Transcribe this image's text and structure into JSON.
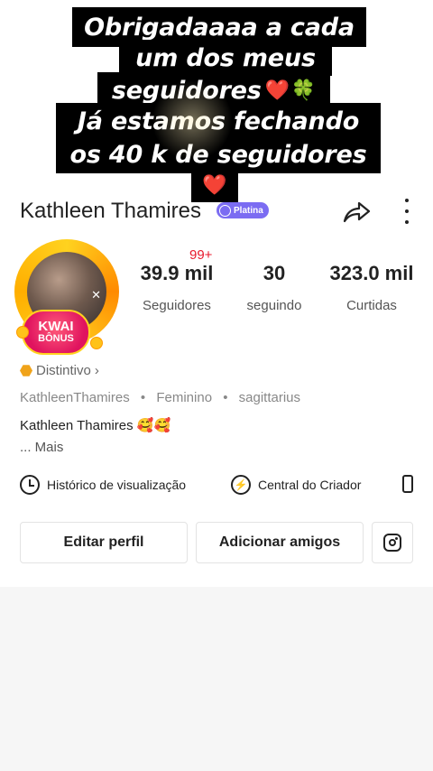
{
  "overlay": {
    "line1": "Obrigadaaaa a cada",
    "line2": "um dos meus",
    "line3": "seguidores",
    "line4": "Já estamos fechando",
    "line5": "os 40 k de seguidores",
    "heart": "❤️",
    "clover": "🍀"
  },
  "profile": {
    "name": "Kathleen Thamires",
    "tier_badge": "Platina",
    "notification_count": "99+",
    "avatar_badge_line1": "KWAI",
    "avatar_badge_line2": "BÔNUS",
    "distintivo": "Distintivo",
    "username": "KathleenThamires",
    "gender": "Feminino",
    "sign": "sagittarius",
    "bio": "Kathleen Thamires 🥰🥰",
    "more": "... Mais"
  },
  "stats": [
    {
      "value": "39.9 mil",
      "label": "Seguidores"
    },
    {
      "value": "30",
      "label": "seguindo"
    },
    {
      "value": "323.0 mil",
      "label": "Curtidas"
    }
  ],
  "quick_links": {
    "history": "Histórico de visualização",
    "creator": "Central do Criador"
  },
  "buttons": {
    "edit": "Editar perfil",
    "add_friends": "Adicionar amigos"
  },
  "icons": {
    "share": "share-arrow-icon",
    "more": "more-vertical-icon",
    "history": "clock-icon",
    "creator": "lightning-icon",
    "shop": "bag-icon",
    "instagram": "instagram-icon"
  }
}
